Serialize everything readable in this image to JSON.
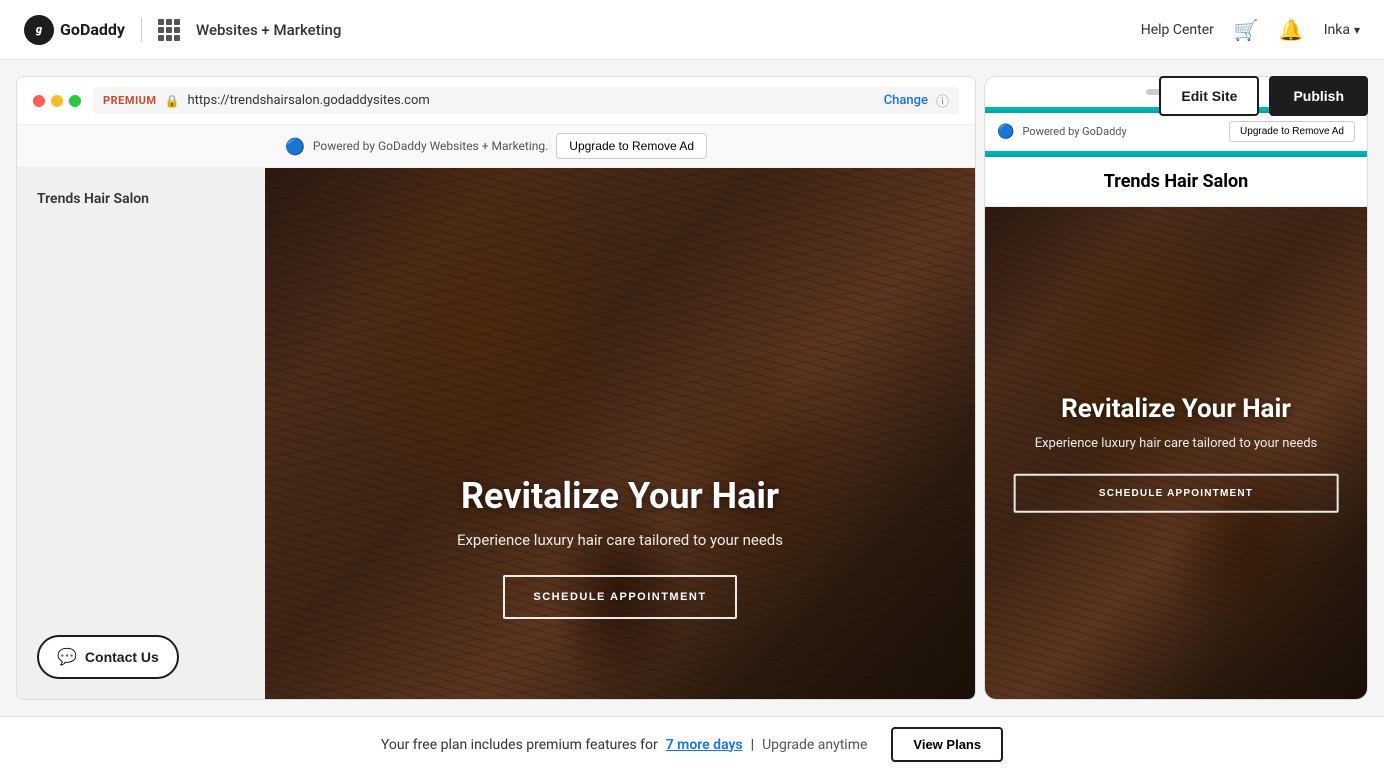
{
  "navbar": {
    "logo_text": "GoDaddy",
    "app_name": "Websites + Marketing",
    "help_center": "Help Center",
    "user_name": "Inka"
  },
  "toolbar": {
    "edit_site_label": "Edit Site",
    "publish_label": "Publish"
  },
  "browser": {
    "badge": "PREMIUM",
    "url": "https://trendshairsalon.godaddysites.com",
    "change_label": "Change",
    "ad_text": "Powered by GoDaddy Websites + Marketing.",
    "upgrade_label": "Upgrade to Remove Ad"
  },
  "website": {
    "site_name": "Trends Hair Salon",
    "hero_title": "Revitalize Your Hair",
    "hero_subtitle": "Experience luxury hair care tailored to your needs",
    "schedule_btn": "SCHEDULE APPOINTMENT",
    "contact_btn": "Contact Us"
  },
  "mobile_preview": {
    "site_title": "Trends Hair Salon",
    "ad_text": "Powered by GoDaddy",
    "upgrade_label": "Upgrade to Remove Ad",
    "hero_title": "Revitalize Your Hair",
    "hero_subtitle": "Experience luxury hair care tailored to your needs",
    "schedule_btn": "SCHEDULE APPOINTMENT"
  },
  "bottom_banner": {
    "text_before": "Your free plan includes premium features for",
    "days_link": "7 more days",
    "separator": "|",
    "upgrade_text": "Upgrade anytime",
    "view_plans_btn": "View Plans"
  }
}
